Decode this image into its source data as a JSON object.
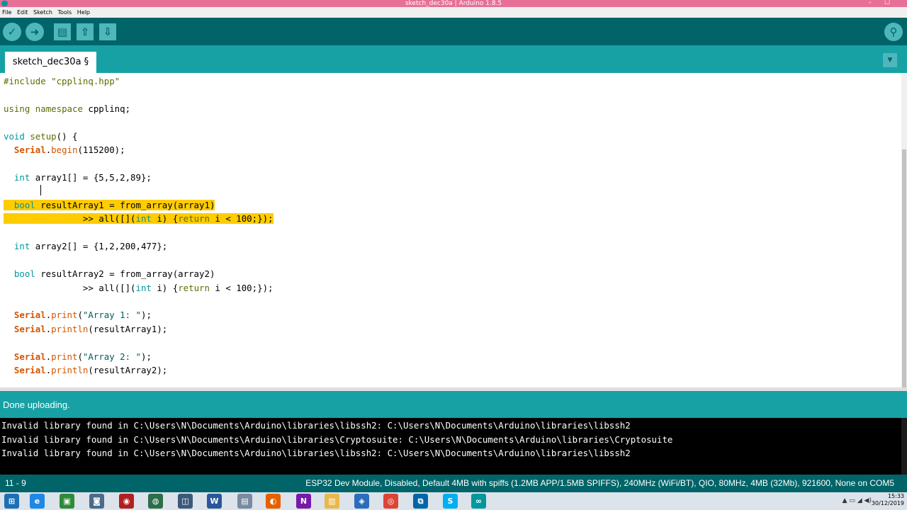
{
  "window": {
    "title": "sketch_dec30a | Arduino 1.8.5",
    "controls": [
      "–",
      "☐"
    ]
  },
  "menu": [
    "File",
    "Edit",
    "Sketch",
    "Tools",
    "Help"
  ],
  "toolbar": {
    "icons": [
      "verify-icon",
      "upload-icon",
      "new-icon",
      "open-icon",
      "save-icon",
      "serial-monitor-icon"
    ]
  },
  "tab": {
    "label": "sketch_dec30a §",
    "menu_icon": "▼"
  },
  "code_lines": [
    [
      {
        "t": "#include \"cpplinq.hpp\"",
        "c": "pre"
      }
    ],
    [],
    [
      {
        "t": "using",
        "c": "kw2"
      },
      {
        "t": " ",
        "c": ""
      },
      {
        "t": "namespace",
        "c": "kw2"
      },
      {
        "t": " cpplinq;",
        "c": ""
      }
    ],
    [],
    [
      {
        "t": "void",
        "c": "kw"
      },
      {
        "t": " ",
        "c": ""
      },
      {
        "t": "setup",
        "c": "kw2"
      },
      {
        "t": "() {",
        "c": ""
      }
    ],
    [
      {
        "t": "  ",
        "c": ""
      },
      {
        "t": "Serial",
        "c": "obj"
      },
      {
        "t": ".",
        "c": ""
      },
      {
        "t": "begin",
        "c": "fn"
      },
      {
        "t": "(115200);",
        "c": ""
      }
    ],
    [],
    [
      {
        "t": "  ",
        "c": ""
      },
      {
        "t": "int",
        "c": "kw"
      },
      {
        "t": " array1[] = {5,5,2,89};",
        "c": ""
      }
    ],
    [],
    [
      {
        "t": "  ",
        "c": "hl"
      },
      {
        "t": "bool",
        "c": "hl kw"
      },
      {
        "t": " resultArray1 = from_array(array1)",
        "c": "hl"
      }
    ],
    [
      {
        "t": "               >> all([](",
        "c": "hl"
      },
      {
        "t": "int",
        "c": "hl kw"
      },
      {
        "t": " i) {",
        "c": "hl"
      },
      {
        "t": "return",
        "c": "hl kw2"
      },
      {
        "t": " i < 100;});",
        "c": "hl"
      }
    ],
    [],
    [
      {
        "t": "  ",
        "c": ""
      },
      {
        "t": "int",
        "c": "kw"
      },
      {
        "t": " array2[] = {1,2,200,477};",
        "c": ""
      }
    ],
    [],
    [
      {
        "t": "  ",
        "c": ""
      },
      {
        "t": "bool",
        "c": "kw"
      },
      {
        "t": " resultArray2 = from_array(array2)",
        "c": ""
      }
    ],
    [
      {
        "t": "               >> all([](",
        "c": ""
      },
      {
        "t": "int",
        "c": "kw"
      },
      {
        "t": " i) {",
        "c": ""
      },
      {
        "t": "return",
        "c": "kw2"
      },
      {
        "t": " i < 100;});",
        "c": ""
      }
    ],
    [],
    [
      {
        "t": "  ",
        "c": ""
      },
      {
        "t": "Serial",
        "c": "obj"
      },
      {
        "t": ".",
        "c": ""
      },
      {
        "t": "print",
        "c": "fn"
      },
      {
        "t": "(",
        "c": ""
      },
      {
        "t": "\"Array 1: \"",
        "c": "str"
      },
      {
        "t": ");",
        "c": ""
      }
    ],
    [
      {
        "t": "  ",
        "c": ""
      },
      {
        "t": "Serial",
        "c": "obj"
      },
      {
        "t": ".",
        "c": ""
      },
      {
        "t": "println",
        "c": "fn"
      },
      {
        "t": "(resultArray1);",
        "c": ""
      }
    ],
    [],
    [
      {
        "t": "  ",
        "c": ""
      },
      {
        "t": "Serial",
        "c": "obj"
      },
      {
        "t": ".",
        "c": ""
      },
      {
        "t": "print",
        "c": "fn"
      },
      {
        "t": "(",
        "c": ""
      },
      {
        "t": "\"Array 2: \"",
        "c": "str"
      },
      {
        "t": ");",
        "c": ""
      }
    ],
    [
      {
        "t": "  ",
        "c": ""
      },
      {
        "t": "Serial",
        "c": "obj"
      },
      {
        "t": ".",
        "c": ""
      },
      {
        "t": "println",
        "c": "fn"
      },
      {
        "t": "(resultArray2);",
        "c": ""
      }
    ]
  ],
  "status": {
    "message": "Done uploading."
  },
  "console_lines": [
    "Invalid library found in C:\\Users\\N\\Documents\\Arduino\\libraries\\libssh2: C:\\Users\\N\\Documents\\Arduino\\libraries\\libssh2",
    "Invalid library found in C:\\Users\\N\\Documents\\Arduino\\libraries\\Cryptosuite: C:\\Users\\N\\Documents\\Arduino\\libraries\\Cryptosuite",
    "Invalid library found in C:\\Users\\N\\Documents\\Arduino\\libraries\\libssh2: C:\\Users\\N\\Documents\\Arduino\\libraries\\libssh2"
  ],
  "footer": {
    "cursor_position": "11 - 9",
    "board_info": "ESP32 Dev Module, Disabled, Default 4MB with spiffs (1.2MB APP/1.5MB SPIFFS), 240MHz (WiFi/BT), QIO, 80MHz, 4MB (32Mb), 921600, None on COM5"
  },
  "taskbar": {
    "apps": [
      {
        "name": "start-icon",
        "glyph": "⊞",
        "color": "#1f6fb5"
      },
      {
        "name": "edge-icon",
        "glyph": "e",
        "color": "#1e88e5"
      },
      {
        "name": "store-icon",
        "glyph": "▣",
        "color": "#2e8b3a"
      },
      {
        "name": "remote-icon",
        "glyph": "◙",
        "color": "#4b6b8a"
      },
      {
        "name": "app-red-icon",
        "glyph": "◉",
        "color": "#b02020"
      },
      {
        "name": "app-green-icon",
        "glyph": "◍",
        "color": "#2c6e49"
      },
      {
        "name": "network-icon",
        "glyph": "◫",
        "color": "#3b5a7a"
      },
      {
        "name": "word-icon",
        "glyph": "W",
        "color": "#2b579a"
      },
      {
        "name": "files-icon",
        "glyph": "▤",
        "color": "#7a8aa0"
      },
      {
        "name": "firefox-icon",
        "glyph": "◐",
        "color": "#e66000"
      },
      {
        "name": "onenote-icon",
        "glyph": "N",
        "color": "#7719aa"
      },
      {
        "name": "explorer-icon",
        "glyph": "▥",
        "color": "#e8b84a"
      },
      {
        "name": "sourcetree-icon",
        "glyph": "◈",
        "color": "#2a6ebb"
      },
      {
        "name": "chrome-icon",
        "glyph": "◎",
        "color": "#db4437"
      },
      {
        "name": "vscode-icon",
        "glyph": "⧉",
        "color": "#0065a9"
      },
      {
        "name": "skype-icon",
        "glyph": "S",
        "color": "#00aff0"
      },
      {
        "name": "arduino-icon",
        "glyph": "∞",
        "color": "#00979d"
      }
    ],
    "time": "15:33",
    "date": "30/12/2019"
  }
}
